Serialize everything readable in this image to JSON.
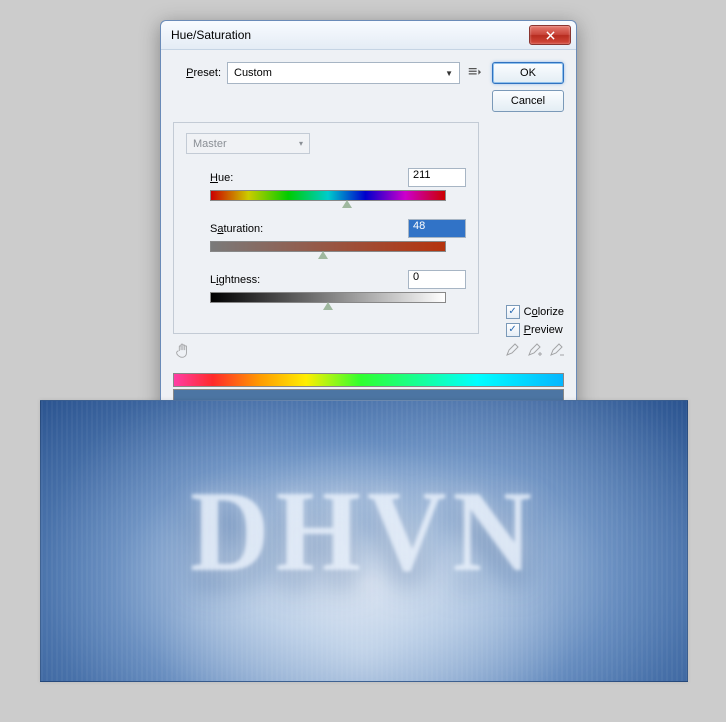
{
  "dialog": {
    "title": "Hue/Saturation",
    "preset_label": "Preset:",
    "preset_value": "Custom",
    "ok_label": "OK",
    "cancel_label": "Cancel",
    "master_label": "Master"
  },
  "sliders": {
    "hue": {
      "label": "Hue:",
      "value": "211",
      "pos": 58
    },
    "saturation": {
      "label": "Saturation:",
      "value": "48",
      "pos": 48,
      "selected": true
    },
    "lightness": {
      "label": "Lightness:",
      "value": "0",
      "pos": 50
    }
  },
  "checkboxes": {
    "colorize": {
      "label": "Colorize",
      "checked": true
    },
    "preview": {
      "label": "Preview",
      "checked": true
    }
  },
  "preview_text": "DHVN"
}
